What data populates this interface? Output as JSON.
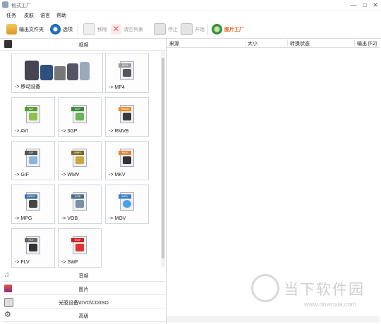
{
  "window": {
    "title": "格式工厂",
    "controls": [
      "—",
      "□",
      "✕"
    ]
  },
  "menu": [
    "任务",
    "皮肤",
    "语言",
    "帮助"
  ],
  "toolbar": {
    "output_folder": "输出文件夹",
    "options": "选项",
    "remove": "移除",
    "clear_list": "清空列表",
    "stop": "停止",
    "start": "开始",
    "picture_tool": "图片工厂"
  },
  "left": {
    "video_category": "视频",
    "tiles": [
      {
        "label": "-> 移动设备",
        "icon": "mobile-devices-icon"
      },
      {
        "label": "-> MP4",
        "icon": "mp4-file-icon",
        "tag": "MP4"
      },
      {
        "label": "-> AVI",
        "icon": "avi-file-icon",
        "tag": "AVI"
      },
      {
        "label": "-> 3GP",
        "icon": "3gp-file-icon",
        "tag": "3GP"
      },
      {
        "label": "-> RMVB",
        "icon": "rmvb-file-icon",
        "tag": "RMVB"
      },
      {
        "label": "-> GIF",
        "icon": "gif-file-icon",
        "tag": "GIF"
      },
      {
        "label": "-> WMV",
        "icon": "wmv-file-icon",
        "tag": "WMV"
      },
      {
        "label": "-> MKV",
        "icon": "mkv-file-icon",
        "tag": "MKV"
      },
      {
        "label": "-> MPG",
        "icon": "mpg-file-icon",
        "tag": "MPEG"
      },
      {
        "label": "-> VOB",
        "icon": "vob-file-icon",
        "tag": "VOB"
      },
      {
        "label": "-> MOV",
        "icon": "mov-file-icon",
        "tag": "MOV"
      },
      {
        "label": "-> FLV",
        "icon": "flv-file-icon",
        "tag": "FLV"
      },
      {
        "label": "-> SWF",
        "icon": "swf-file-icon",
        "tag": "SWF"
      }
    ],
    "categories": [
      "音频",
      "图片",
      "光驱设备\\DVD\\CD\\ISO",
      "高级"
    ]
  },
  "task_table": {
    "columns": [
      "来源",
      "大小",
      "转换状态",
      "输出 [F2]"
    ]
  },
  "watermark": {
    "name": "当下软件园",
    "url": "www.downxia.com"
  },
  "colors": {
    "accent": "#e85a1b",
    "border": "#cfd6dd",
    "tag_orange": "#f08a24"
  }
}
